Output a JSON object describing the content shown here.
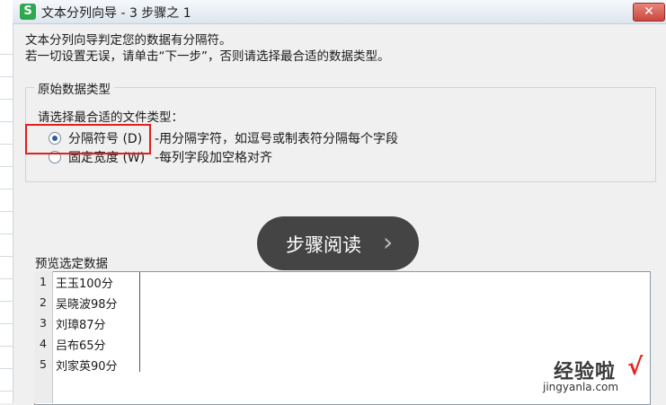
{
  "window": {
    "app_icon_label": "S",
    "title": "文本分列向导 - 3 步骤之 1",
    "close_label": "✕"
  },
  "intro": {
    "line1": "文本分列向导判定您的数据有分隔符。",
    "line2": "若一切设置无误，请单击“下一步”，否则请选择最合适的数据类型。"
  },
  "original_data_type": {
    "group_title": "原始数据类型",
    "choose_label": "请选择最合适的文件类型：",
    "options": [
      {
        "label": "分隔符号 (D)",
        "description": "-用分隔字符，如逗号或制表符分隔每个字段",
        "checked": true
      },
      {
        "label": "固定宽度 (W)",
        "description": "-每列字段加空格对齐",
        "checked": false
      }
    ]
  },
  "reader_overlay": {
    "label": "步骤阅读",
    "chevron_icon": "chevron-right-icon",
    "chevron": "›"
  },
  "preview": {
    "title": "预览选定数据",
    "rows": [
      {
        "num": "1",
        "text": "王玉100分"
      },
      {
        "num": "2",
        "text": "吴晓波98分"
      },
      {
        "num": "3",
        "text": "刘璋87分"
      },
      {
        "num": "4",
        "text": "吕布65分"
      },
      {
        "num": "5",
        "text": "刘家英90分"
      }
    ]
  },
  "watermark": {
    "text": "经验啦",
    "check": "√",
    "url": "jingyanla.com"
  },
  "colors": {
    "highlight_border": "#e0201c",
    "close_button": "#c8473d",
    "app_icon": "#2fa84f",
    "radio_checked": "#2e5f9e"
  }
}
